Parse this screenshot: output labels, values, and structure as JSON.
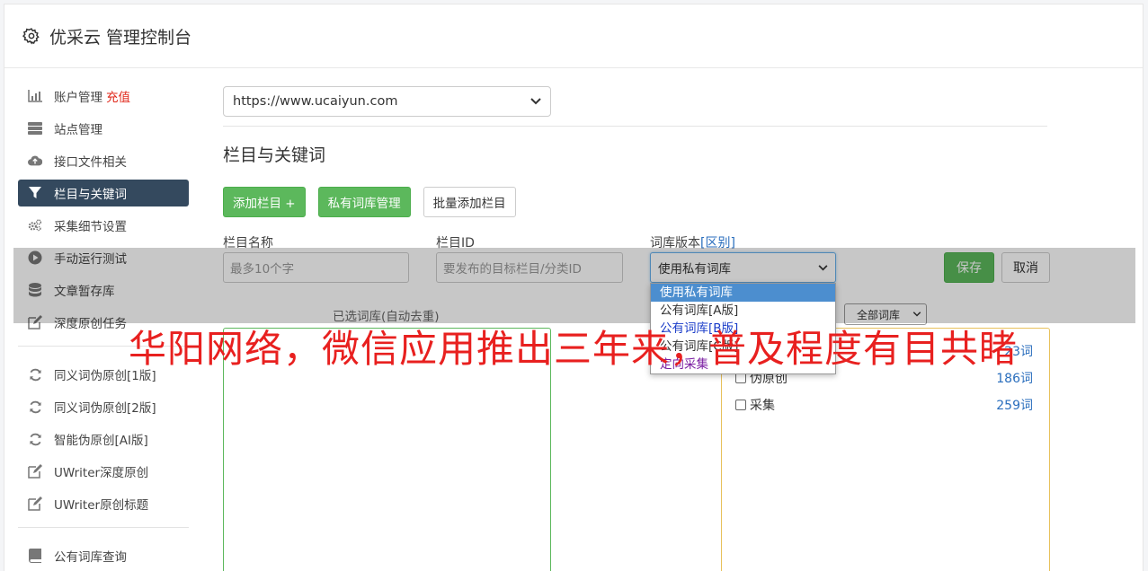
{
  "header": {
    "title": "优采云 管理控制台",
    "icon": "gear-icon"
  },
  "sidebar": {
    "items": [
      {
        "label": "账户管理",
        "badge": "充值",
        "icon": "bar-chart-icon"
      },
      {
        "label": "站点管理",
        "icon": "server-icon"
      },
      {
        "label": "接口文件相关",
        "icon": "cloud-upload-icon"
      },
      {
        "label": "栏目与关键词",
        "icon": "filter-icon",
        "active": true
      },
      {
        "label": "采集细节设置",
        "icon": "cogs-icon"
      },
      {
        "label": "手动运行测试",
        "icon": "play-circle-icon"
      },
      {
        "label": "文章暂存库",
        "icon": "database-icon"
      },
      {
        "label": "深度原创任务",
        "icon": "edit-icon"
      },
      {
        "label": "同义词伪原创[1版]",
        "icon": "refresh-icon"
      },
      {
        "label": "同义词伪原创[2版]",
        "icon": "refresh-icon"
      },
      {
        "label": "智能伪原创[AI版]",
        "icon": "refresh-icon"
      },
      {
        "label": "UWriter深度原创",
        "icon": "edit-icon"
      },
      {
        "label": "UWriter原创标题",
        "icon": "edit-icon"
      },
      {
        "label": "公有词库查询",
        "icon": "book-icon"
      }
    ]
  },
  "main": {
    "site_select": "https://www.ucaiyun.com",
    "section_title": "栏目与关键词",
    "buttons": {
      "add_column": "添加栏目 +",
      "private_lib": "私有词库管理",
      "batch_add": "批量添加栏目"
    },
    "form": {
      "label_name": "栏目名称",
      "label_id": "栏目ID",
      "label_version": "词库版本",
      "label_diff": "[区别]",
      "name_placeholder": "最多10个字",
      "id_placeholder": "要发布的目标栏目/分类ID",
      "version_value": "使用私有词库",
      "save": "保存",
      "cancel": "取消"
    },
    "dropdown_options": [
      "使用私有词库",
      "公有词库[A版]",
      "公有词库[B版]",
      "公有词库[C版]",
      "定向采集"
    ],
    "selected_label": "已选词库(自动去重)",
    "all_lib_select": "全部词库",
    "libraries": [
      {
        "name": "",
        "count": "23词"
      },
      {
        "name": "伪原创",
        "count": "186词"
      },
      {
        "name": "采集",
        "count": "259词"
      }
    ]
  },
  "watermark": "华阳网络，微信应用推出三年来，普及程度有目共睹"
}
